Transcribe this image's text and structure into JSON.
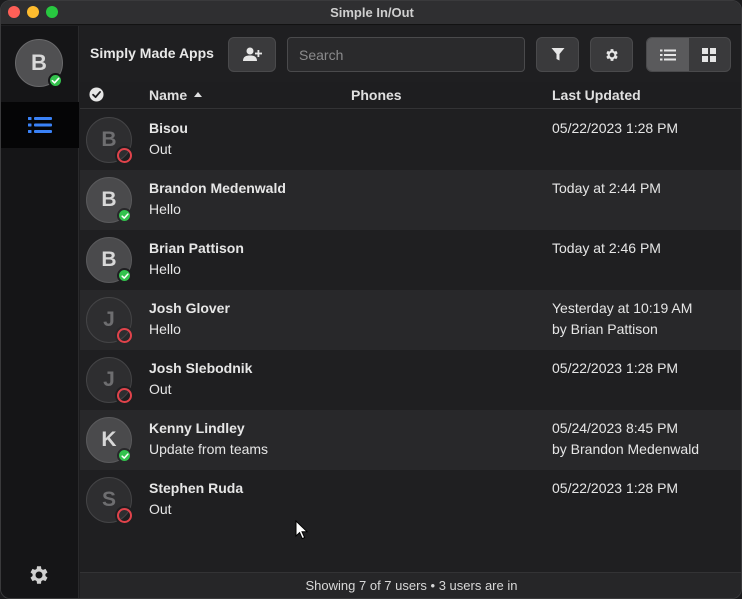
{
  "window": {
    "title": "Simple In/Out"
  },
  "sidebar": {
    "me": {
      "initial": "B",
      "status": "in"
    },
    "nav_list_icon": "list-icon",
    "settings_icon": "gear-icon"
  },
  "toolbar": {
    "app_name": "Simply Made Apps",
    "add_user_icon": "add-user-icon",
    "search_placeholder": "Search",
    "filter_icon": "filter-icon",
    "settings_icon": "gear-icon",
    "view_list_icon": "list-view-icon",
    "view_grid_icon": "grid-view-icon",
    "active_view": "list"
  },
  "columns": {
    "name": "Name",
    "phones": "Phones",
    "last_updated": "Last Updated",
    "sort": "ascending"
  },
  "users": [
    {
      "initial": "B",
      "name": "Bisou",
      "message": "Out",
      "updated": "05/22/2023 1:28 PM",
      "by": "",
      "status": "out"
    },
    {
      "initial": "B",
      "name": "Brandon Medenwald",
      "message": "Hello",
      "updated": "Today at 2:44 PM",
      "by": "",
      "status": "in"
    },
    {
      "initial": "B",
      "name": "Brian Pattison",
      "message": "Hello",
      "updated": "Today at 2:46 PM",
      "by": "",
      "status": "in"
    },
    {
      "initial": "J",
      "name": "Josh Glover",
      "message": "Hello",
      "updated": "Yesterday at 10:19 AM",
      "by": "by Brian Pattison",
      "status": "out"
    },
    {
      "initial": "J",
      "name": "Josh Slebodnik",
      "message": "Out",
      "updated": "05/22/2023 1:28 PM",
      "by": "",
      "status": "out"
    },
    {
      "initial": "K",
      "name": "Kenny Lindley",
      "message": "Update from teams",
      "updated": "05/24/2023 8:45 PM",
      "by": "by Brandon Medenwald",
      "status": "in"
    },
    {
      "initial": "S",
      "name": "Stephen Ruda",
      "message": "Out",
      "updated": "05/22/2023 1:28 PM",
      "by": "",
      "status": "out"
    }
  ],
  "footer": {
    "summary": "Showing 7 of 7 users • 3 users are in"
  },
  "colors": {
    "in": "#33c24d",
    "out": "#e0434b",
    "accent": "#3a82f7"
  }
}
